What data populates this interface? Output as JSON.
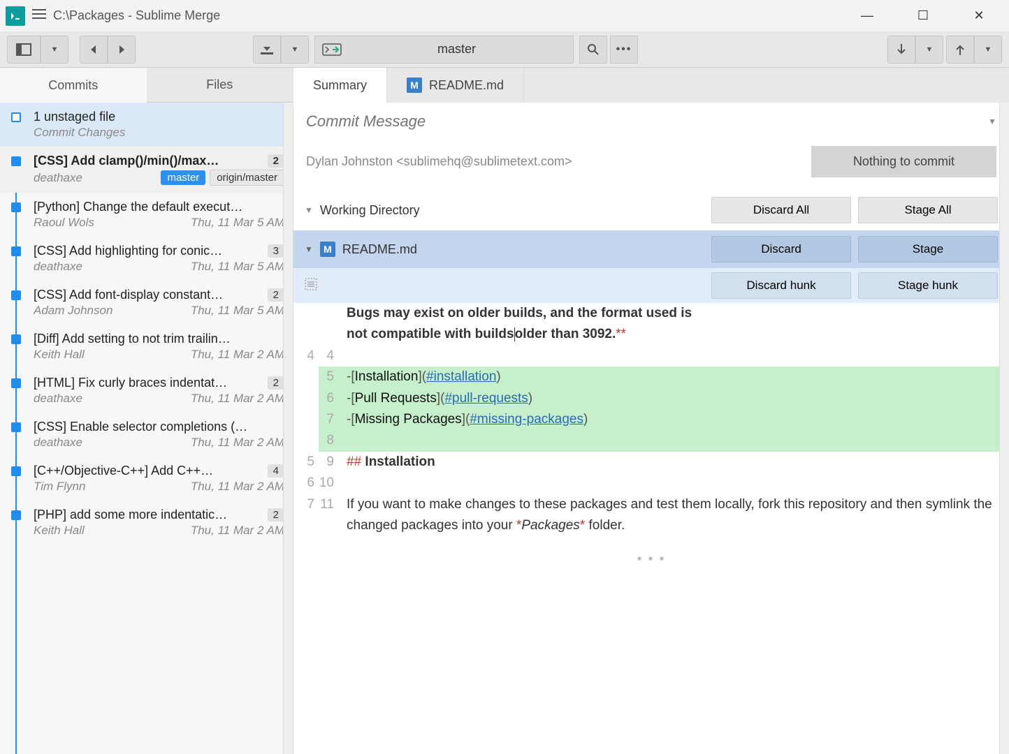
{
  "titlebar": {
    "path": "C:\\Packages - Sublime Merge"
  },
  "toolbar": {
    "branch": "master"
  },
  "sidebar": {
    "tabs": {
      "commits": "Commits",
      "files": "Files"
    },
    "uncommitted": {
      "line1": "1 unstaged file",
      "line2": "Commit Changes"
    },
    "commits": [
      {
        "title": "[CSS] Add clamp()/min()/max…",
        "author": "deathaxe",
        "date": "",
        "badge": "2",
        "master": "master",
        "origin": "origin/master",
        "bold": true
      },
      {
        "title": "[Python] Change the default execut…",
        "author": "Raoul Wols",
        "date": "Thu, 11 Mar 5 AM",
        "badge": ""
      },
      {
        "title": "[CSS] Add highlighting for conic…",
        "author": "deathaxe",
        "date": "Thu, 11 Mar 5 AM",
        "badge": "3"
      },
      {
        "title": "[CSS] Add font-display constant…",
        "author": "Adam Johnson",
        "date": "Thu, 11 Mar 5 AM",
        "badge": "2"
      },
      {
        "title": "[Diff] Add setting to not trim trailin…",
        "author": "Keith Hall",
        "date": "Thu, 11 Mar 2 AM",
        "badge": ""
      },
      {
        "title": "[HTML] Fix curly braces indentat…",
        "author": "deathaxe",
        "date": "Thu, 11 Mar 2 AM",
        "badge": "2"
      },
      {
        "title": "[CSS] Enable selector completions (…",
        "author": "deathaxe",
        "date": "Thu, 11 Mar 2 AM",
        "badge": ""
      },
      {
        "title": "[C++/Objective-C++] Add C++…",
        "author": "Tim Flynn",
        "date": "Thu, 11 Mar 2 AM",
        "badge": "4"
      },
      {
        "title": "[PHP] add some more indentatic…",
        "author": "Keith Hall",
        "date": "Thu, 11 Mar 2 AM",
        "badge": "2"
      }
    ]
  },
  "main": {
    "tabs": {
      "summary": "Summary",
      "file": "README.md"
    },
    "commit_msg_placeholder": "Commit Message",
    "author": "Dylan Johnston <sublimehq@sublimetext.com>",
    "commit_button": "Nothing to commit",
    "wd_label": "Working Directory",
    "discard_all": "Discard All",
    "stage_all": "Stage All",
    "file_name": "README.md",
    "discard": "Discard",
    "stage": "Stage",
    "discard_hunk": "Discard hunk",
    "stage_hunk": "Stage hunk"
  },
  "diff": {
    "context_top_1": "Bugs may exist on older builds, and the format used is",
    "context_top_2a": "not compatible with builds",
    "context_top_2b": "older than 3092.",
    "line5_pre": "-[",
    "line5_txt": "Installation",
    "line5_mid": "](",
    "line5_url": "#installation",
    "line5_suf": ")",
    "line6_pre": "-[",
    "line6_txt": "Pull Requests",
    "line6_mid": "](",
    "line6_url": "#pull-requests",
    "line6_suf": ")",
    "line7_pre": "-[",
    "line7_txt": "Missing Packages",
    "line7_mid": "](",
    "line7_url": "#missing-packages",
    "line7_suf": ")",
    "line9_hash": "## ",
    "line9_txt": "Installation",
    "line11": "If you want to make changes to these packages and test them locally, fork this repository and then symlink the changed packages into your ",
    "line11_em": "Packages",
    "line11_suf": " folder.",
    "ln_old": {
      "r4": "4",
      "r5": "5",
      "r6": "6",
      "r7": "7"
    },
    "ln_new": {
      "r4": "4",
      "r5": "5",
      "r6": "6",
      "r7": "7",
      "r8": "8",
      "r9": "9",
      "r10": "10",
      "r11": "11"
    }
  }
}
